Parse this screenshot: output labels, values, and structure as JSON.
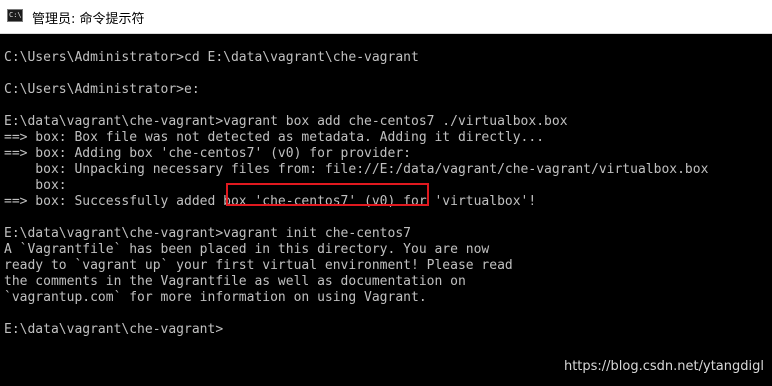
{
  "window": {
    "title": "管理员: 命令提示符",
    "icon_name": "cmd-icon",
    "icon_glyph": "C:\\"
  },
  "console": {
    "lines": [
      "C:\\Users\\Administrator>cd E:\\data\\vagrant\\che-vagrant",
      "",
      "C:\\Users\\Administrator>e:",
      "",
      "E:\\data\\vagrant\\che-vagrant>vagrant box add che-centos7 ./virtualbox.box",
      "==> box: Box file was not detected as metadata. Adding it directly...",
      "==> box: Adding box 'che-centos7' (v0) for provider:",
      "    box: Unpacking necessary files from: file://E:/data/vagrant/che-vagrant/virtualbox.box",
      "    box:",
      "==> box: Successfully added box 'che-centos7' (v0) for 'virtualbox'!",
      "",
      "E:\\data\\vagrant\\che-vagrant>vagrant init che-centos7",
      "A `Vagrantfile` has been placed in this directory. You are now",
      "ready to `vagrant up` your first virtual environment! Please read",
      "the comments in the Vagrantfile as well as documentation on",
      "`vagrantup.com` for more information on using Vagrant.",
      "",
      "E:\\data\\vagrant\\che-vagrant>"
    ],
    "highlighted_command": "vagrant init che-centos7",
    "highlight_color": "#e0191f",
    "text_color": "#c0c0c0",
    "background_color": "#000000"
  },
  "watermark": {
    "text": "https://blog.csdn.net/ytangdigl"
  }
}
